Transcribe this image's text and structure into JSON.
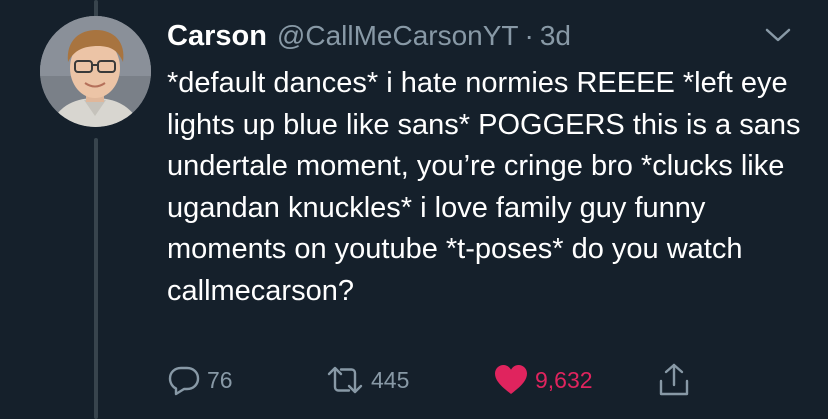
{
  "tweet": {
    "display_name": "Carson",
    "handle": "@CallMeCarsonYT",
    "separator": "·",
    "time": "3d",
    "text": "*default dances* i hate normies REEEE *left eye lights up blue like sans* POGGERS this is a sans undertale moment, you’re cringe bro *clucks like ugandan knuckles* i love family guy funny moments on youtube *t-poses* do you watch callmecarson?"
  },
  "actions": {
    "replies": "76",
    "retweets": "445",
    "likes": "9,632"
  },
  "icons": {
    "reply": "reply-icon",
    "retweet": "retweet-icon",
    "like": "heart-icon",
    "share": "share-icon",
    "menu": "chevron-down-icon"
  },
  "colors": {
    "background": "#15202b",
    "text": "#ffffff",
    "secondary": "#8899a6",
    "like": "#e0245e",
    "thread": "#38444d"
  }
}
